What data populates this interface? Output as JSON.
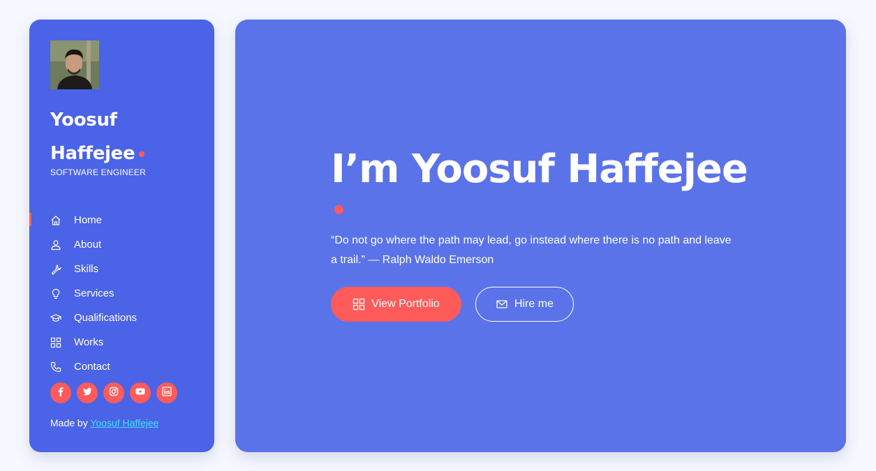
{
  "sidebar": {
    "name_line1": "Yoosuf",
    "name_line2": "Haffejee",
    "role": "SOFTWARE ENGINEER",
    "nav": [
      {
        "label": "Home",
        "icon": "home-icon",
        "active": true
      },
      {
        "label": "About",
        "icon": "user-icon",
        "active": false
      },
      {
        "label": "Skills",
        "icon": "wrench-icon",
        "active": false
      },
      {
        "label": "Services",
        "icon": "lightbulb-icon",
        "active": false
      },
      {
        "label": "Qualifications",
        "icon": "graduation-cap-icon",
        "active": false
      },
      {
        "label": "Works",
        "icon": "grid-icon",
        "active": false
      },
      {
        "label": "Contact",
        "icon": "phone-icon",
        "active": false
      }
    ],
    "socials": [
      "facebook-icon",
      "twitter-icon",
      "instagram-icon",
      "youtube-icon",
      "linkedin-icon"
    ],
    "credit_prefix": "Made by",
    "credit_link": "Yoosuf Haffejee"
  },
  "hero": {
    "title": "I’m Yoosuf Haffejee",
    "quote": "“Do not go where the path may lead, go instead where there is no path and leave a trail.” — Ralph Waldo Emerson",
    "primary_button": "View Portfolio",
    "secondary_button": "Hire me"
  },
  "colors": {
    "background": "#f6f8ff",
    "sidebar": "#4b63e6",
    "main": "#5b73e8",
    "accent": "#ff5b5b",
    "link": "#3ee0ff"
  }
}
